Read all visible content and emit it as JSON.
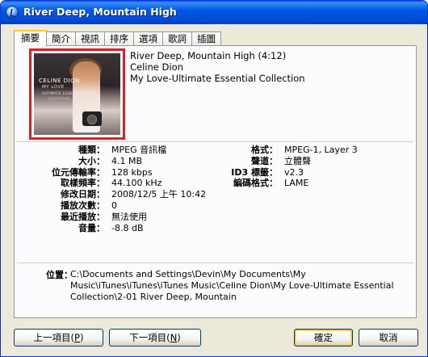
{
  "window": {
    "title": "River Deep, Mountain High"
  },
  "tabs": [
    {
      "label": "摘要"
    },
    {
      "label": "簡介"
    },
    {
      "label": "視訊"
    },
    {
      "label": "排序"
    },
    {
      "label": "選項"
    },
    {
      "label": "歌詞"
    },
    {
      "label": "插圖"
    }
  ],
  "album_art": {
    "line1": "CELINE DION",
    "line2": "MY LOVE",
    "line3": "ULTIMATE ESSENTIAL",
    "line4": "COLLECTION"
  },
  "track": {
    "title_line": "River Deep, Mountain High (4:12)",
    "artist": "Celine Dion",
    "album": "My Love-Ultimate Essential Collection"
  },
  "props_left": [
    {
      "label": "種類：",
      "value": "MPEG 音訊檔"
    },
    {
      "label": "大小：",
      "value": "4.1 MB"
    },
    {
      "label": "位元傳輸率：",
      "value": "128 kbps"
    },
    {
      "label": "取樣頻率：",
      "value": "44.100 kHz"
    },
    {
      "label": "修改日期：",
      "value": "2008/12/5 上午 10:42"
    },
    {
      "label": "播放次數：",
      "value": "0"
    },
    {
      "label": "最近播放：",
      "value": "無法使用"
    },
    {
      "label": "音量：",
      "value": "-8.8 dB"
    }
  ],
  "props_right": [
    {
      "label": "格式：",
      "value": "MPEG-1, Layer 3"
    },
    {
      "label": "聲道：",
      "value": "立體聲"
    },
    {
      "label": "ID3 標籤：",
      "value": "v2.3"
    },
    {
      "label": "編碼格式：",
      "value": "LAME"
    }
  ],
  "location": {
    "label": "位置：",
    "path": "C:\\Documents and Settings\\Devin\\My Documents\\My Music\\iTunes\\iTunes\\iTunes Music\\Celine Dion\\My Love-Ultimate Essential Collection\\2-01 River Deep, Mountain"
  },
  "buttons": {
    "prev": {
      "label": "上一項目(",
      "key": "P",
      "suffix": ")"
    },
    "next": {
      "label": "下一項目(",
      "key": "N",
      "suffix": ")"
    },
    "ok": "確定",
    "cancel": "取消"
  }
}
